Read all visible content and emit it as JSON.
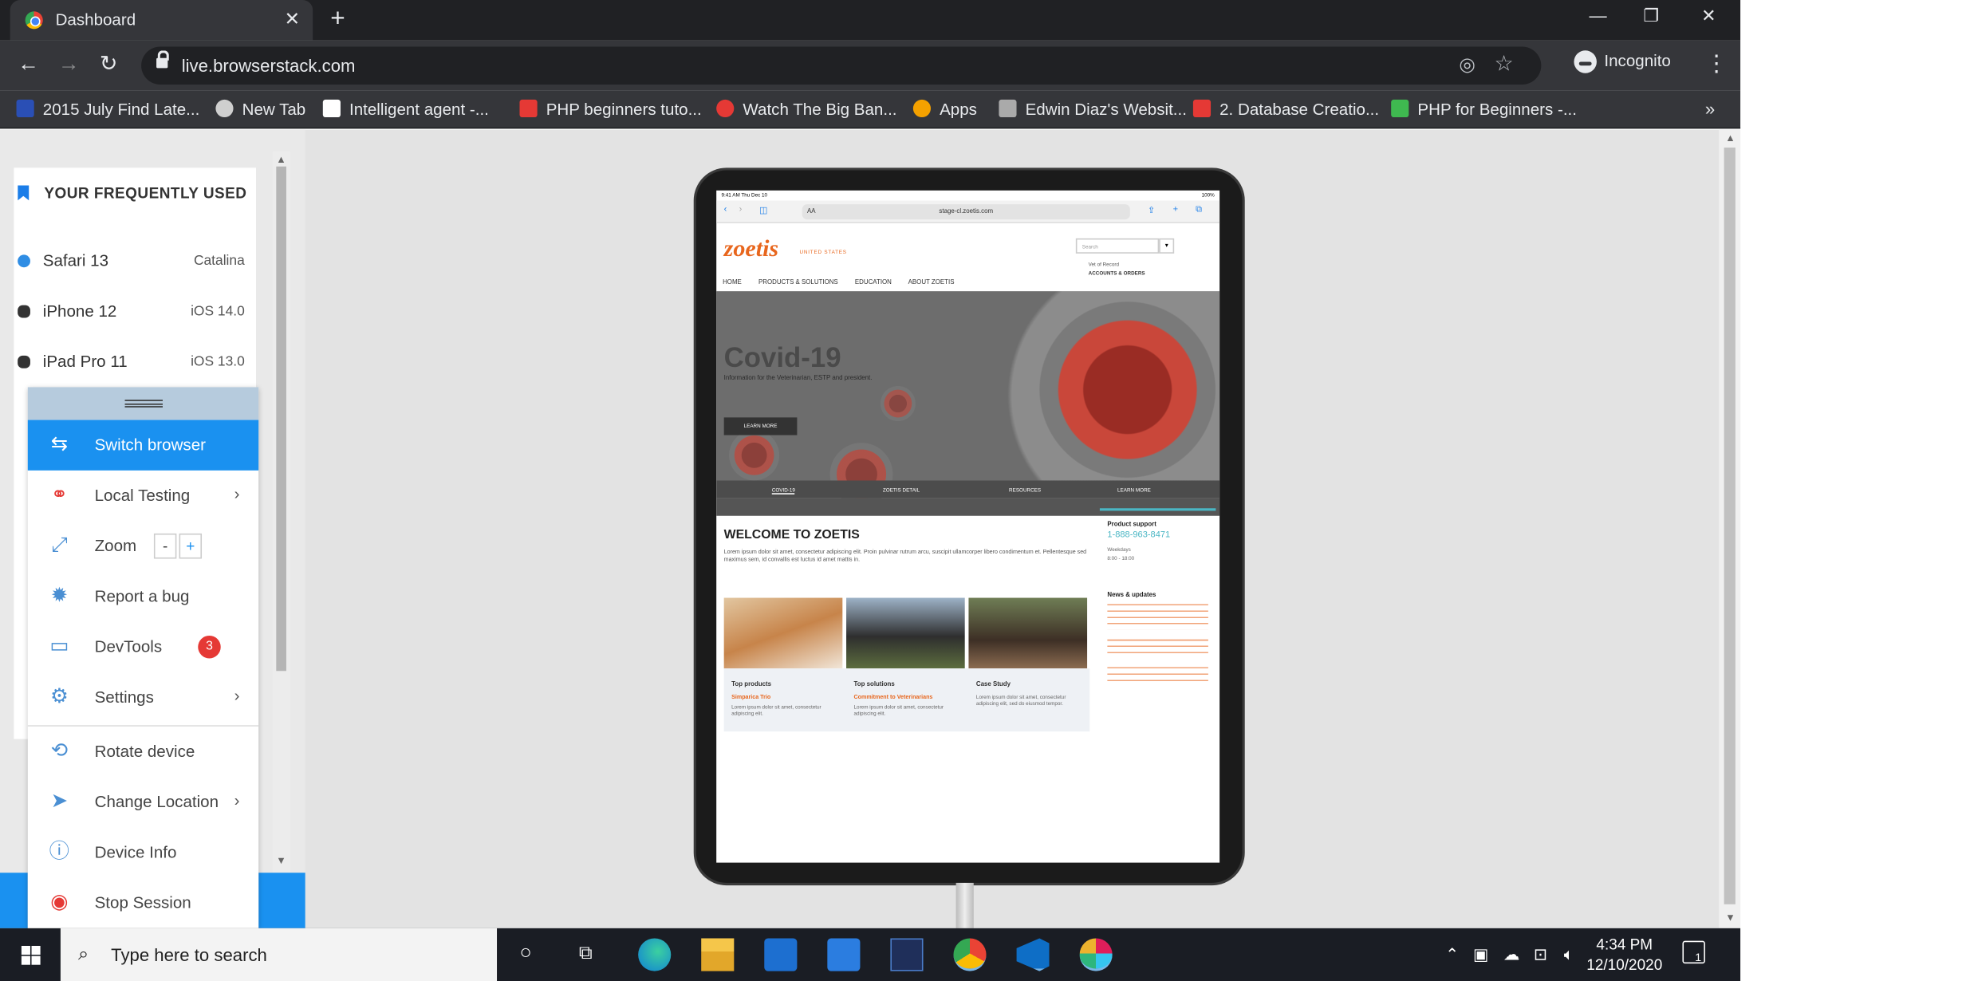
{
  "browser": {
    "tab_title": "Dashboard",
    "url": "live.browserstack.com",
    "mode_label": "Incognito"
  },
  "bookmarks": [
    {
      "label": "2015 July Find Late...",
      "color": "#2a4fb5"
    },
    {
      "label": "New Tab",
      "color": "#cfcfcf"
    },
    {
      "label": "Intelligent agent -...",
      "color": "#ffffff"
    },
    {
      "label": "PHP beginners tuto...",
      "color": "#e53935"
    },
    {
      "label": "Watch The Big Ban...",
      "color": "#e53935"
    },
    {
      "label": "Apps",
      "color": "#f4a100"
    },
    {
      "label": "Edwin Diaz's Websit...",
      "color": "#aaaaaa"
    },
    {
      "label": "2. Database Creatio...",
      "color": "#e53935"
    },
    {
      "label": "PHP for Beginners -...",
      "color": "#3fb950"
    }
  ],
  "frequent": {
    "title": "YOUR FREQUENTLY USED",
    "items": [
      {
        "name": "Safari 13",
        "version": "Catalina"
      },
      {
        "name": "iPhone 12",
        "version": "iOS 14.0"
      },
      {
        "name": "iPad Pro 11",
        "version": "iOS 13.0"
      }
    ]
  },
  "toolbar": {
    "switch_browser": "Switch browser",
    "local_testing": "Local Testing",
    "zoom": "Zoom",
    "zoom_minus": "-",
    "zoom_plus": "+",
    "report_bug": "Report a bug",
    "devtools": "DevTools",
    "devtools_badge": "3",
    "settings": "Settings",
    "rotate": "Rotate device",
    "change_location": "Change Location",
    "device_info": "Device Info",
    "stop_session": "Stop Session"
  },
  "device": {
    "status_left": "9:41 AM  Thu Dec 10",
    "status_right": "100%",
    "safari_aa": "AA",
    "safari_url": "stage-cl.zoetis.com",
    "logo": "zoetis",
    "logo_sub": "UNITED STATES",
    "search_placeholder": "Search",
    "vet_link": "Vet of Record",
    "accounts": "ACCOUNTS & ORDERS",
    "nav": [
      "HOME",
      "PRODUCTS & SOLUTIONS",
      "EDUCATION",
      "ABOUT ZOETIS"
    ],
    "hero_title": "Covid-19",
    "hero_sub": "Information for the Veterinarian, ESTP and president.",
    "hero_btn": "LEARN MORE",
    "tabs": [
      "COVID-19",
      "ZOETIS DETAIL",
      "RESOURCES",
      "LEARN MORE"
    ],
    "welcome": "WELCOME TO ZOETIS",
    "lorem": "Lorem ipsum dolor sit amet, consectetur adipiscing elit. Proin pulvinar rutrum arcu, suscipit ullamcorper libero condimentum et. Pellentesque sed maximus sem, id convallis est luctus id amet mattis in.",
    "cards": [
      {
        "title": "Top products",
        "sub": "Simparica Trio",
        "body": "Lorem ipsum dolor sit amet, consectetur adipiscing elit."
      },
      {
        "title": "Top solutions",
        "sub": "Commitment to Veterinarians",
        "body": "Lorem ipsum dolor sit amet, consectetur adipiscing elit."
      },
      {
        "title": "Case Study",
        "sub": "",
        "body": "Lorem ipsum dolor sit amet, consectetur adipiscing elit, sed do eiusmod tempor."
      }
    ],
    "support_title": "Product support",
    "support_phone": "1-888-963-8471",
    "support_hours": "Weekdays",
    "support_line2": "8:00 - 18:00",
    "news_title": "News & updates"
  },
  "taskbar": {
    "search_placeholder": "Type here to search",
    "time": "4:34 PM",
    "date": "12/10/2020",
    "notifications": "1"
  }
}
